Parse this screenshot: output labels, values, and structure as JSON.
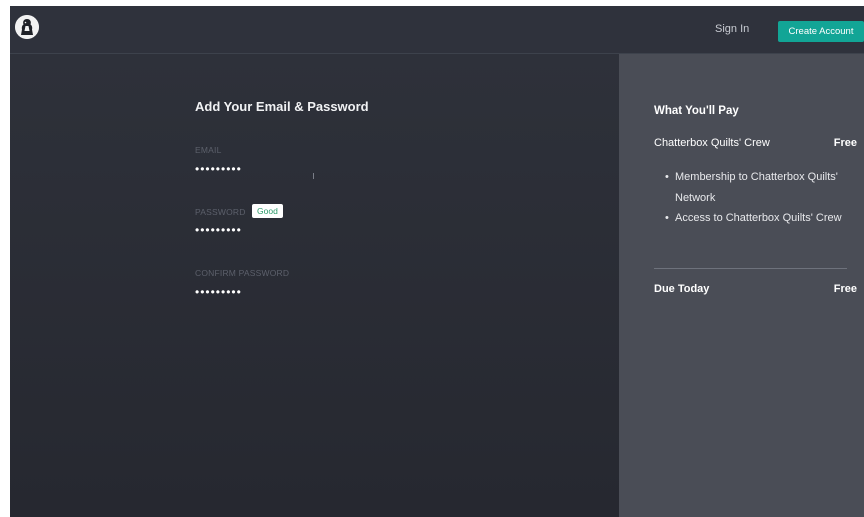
{
  "header": {
    "sign_in": "Sign In",
    "create_account": "Create Account"
  },
  "form": {
    "title": "Add Your Email & Password",
    "email_label": "EMAIL",
    "email_value": "•••••••••",
    "password_label": "PASSWORD",
    "password_strength": "Good",
    "password_value": "•••••••••",
    "confirm_label": "CONFIRM PASSWORD",
    "confirm_value": "•••••••••"
  },
  "summary": {
    "title": "What You'll Pay",
    "plan_name": "Chatterbox Quilts' Crew",
    "plan_price": "Free",
    "features": [
      "Membership to Chatterbox Quilts' Network",
      "Access to Chatterbox Quilts' Crew"
    ],
    "due_label": "Due Today",
    "due_value": "Free"
  },
  "colors": {
    "accent": "#12a596",
    "left_panel": "#2c2f38",
    "right_panel": "#4a4d56",
    "strength_good": "#2c9a6a"
  }
}
